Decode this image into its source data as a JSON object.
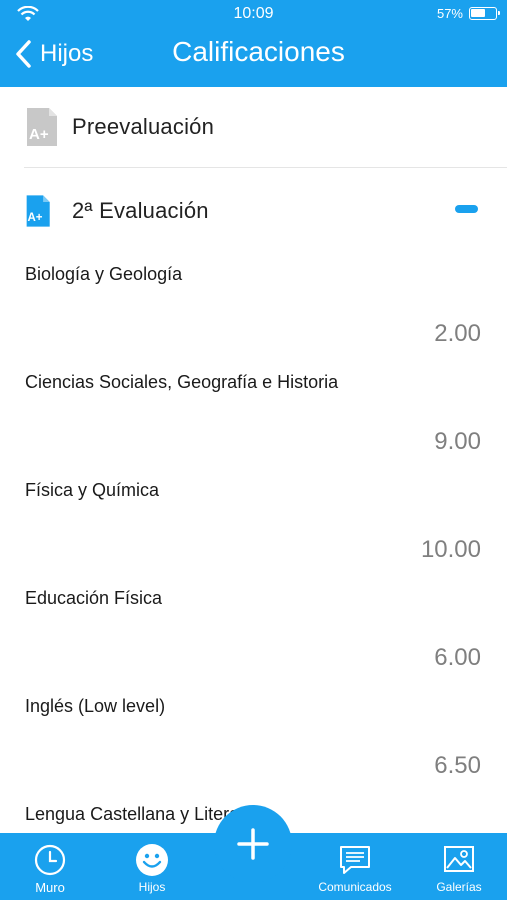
{
  "status_bar": {
    "time": "10:09",
    "battery": "57%"
  },
  "header": {
    "back_label": "Hijos",
    "title": "Calificaciones"
  },
  "sections": {
    "pre": {
      "label": "Preevaluación",
      "icon": "document-grade-icon"
    },
    "eval": {
      "label": "2ª Evaluación",
      "icon": "document-grade-icon"
    }
  },
  "subjects": [
    {
      "name": "Biología y Geología",
      "grade": "2.00"
    },
    {
      "name": "Ciencias Sociales, Geografía e Historia",
      "grade": "9.00"
    },
    {
      "name": "Física y Química",
      "grade": "10.00"
    },
    {
      "name": "Educación Física",
      "grade": "6.00"
    },
    {
      "name": "Inglés (Low level)",
      "grade": "6.50"
    },
    {
      "name": "Lengua Castellana y Literatura",
      "grade": ""
    }
  ],
  "tabbar": {
    "muro": "Muro",
    "hijos": "Hijos",
    "comunicados": "Comunicados",
    "galerias": "Galerías"
  },
  "colors": {
    "accent": "#1aa1ee",
    "grade_text": "#7f7f7f",
    "muted_icon": "#c8c8c8"
  }
}
